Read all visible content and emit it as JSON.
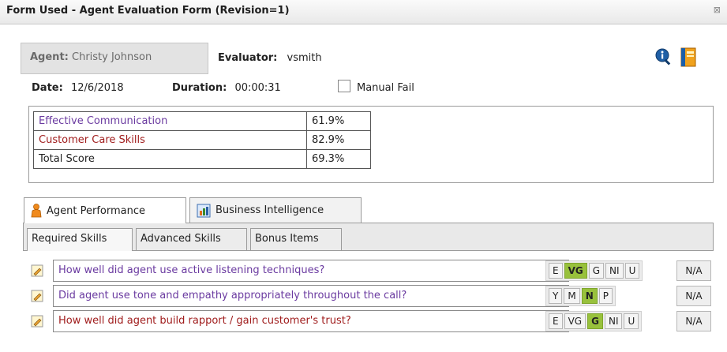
{
  "window": {
    "title": "Form Used - Agent Evaluation Form (Revision=1)",
    "close_glyph": "⊠"
  },
  "header": {
    "agent_label": "Agent:",
    "agent_value": "Christy Johnson",
    "evaluator_label": "Evaluator:",
    "evaluator_value": "vsmith",
    "date_label": "Date:",
    "date_value": "12/6/2018",
    "duration_label": "Duration:",
    "duration_value": "00:00:31",
    "manual_fail_label": "Manual Fail",
    "manual_fail_checked": false
  },
  "scores": [
    {
      "name": "Effective Communication",
      "value": "61.9%",
      "color": "#6a3aa0"
    },
    {
      "name": "Customer Care Skills",
      "value": "82.9%",
      "color": "#a01d1d"
    },
    {
      "name": "Total Score",
      "value": "69.3%",
      "color": "#222222"
    }
  ],
  "outer_tabs": [
    {
      "label": "Agent Performance",
      "icon": "person-icon",
      "active": true
    },
    {
      "label": "Business Intelligence",
      "icon": "chart-icon",
      "active": false
    }
  ],
  "inner_tabs": [
    {
      "label": "Required Skills",
      "active": true
    },
    {
      "label": "Advanced Skills",
      "active": false
    },
    {
      "label": "Bonus Items",
      "active": false
    }
  ],
  "questions": [
    {
      "text": "How well did agent use active listening techniques?",
      "color": "#6a3aa0",
      "options": [
        "E",
        "VG",
        "G",
        "NI",
        "U"
      ],
      "selected": "VG",
      "na_label": "N/A"
    },
    {
      "text": "Did agent use tone and empathy appropriately throughout the call?",
      "color": "#6a3aa0",
      "options": [
        "Y",
        "M",
        "N",
        "P"
      ],
      "selected": "N",
      "na_label": "N/A"
    },
    {
      "text": "How well did agent build rapport / gain customer's trust?",
      "color": "#a01d1d",
      "options": [
        "E",
        "VG",
        "G",
        "NI",
        "U"
      ],
      "selected": "G",
      "na_label": "N/A"
    }
  ],
  "colors": {
    "selected_option": "#98c13c",
    "info_icon": "#1f5fa6"
  }
}
